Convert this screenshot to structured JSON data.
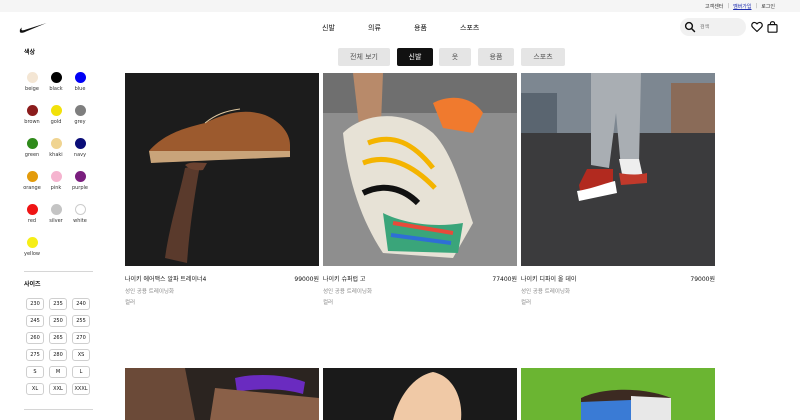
{
  "utility": {
    "customer_center": "고객센터",
    "signup": "멤버가입",
    "login": "로그인"
  },
  "nav": [
    "신발",
    "의류",
    "용품",
    "스포츠"
  ],
  "search": {
    "placeholder": "검색"
  },
  "sidebar": {
    "colors_title": "색상",
    "colors": [
      {
        "label": "beige",
        "hex": "#f4e6d4"
      },
      {
        "label": "black",
        "hex": "#000000"
      },
      {
        "label": "blue",
        "hex": "#0000f5"
      },
      {
        "label": "brown",
        "hex": "#8b1c1c"
      },
      {
        "label": "gold",
        "hex": "#f2e10a"
      },
      {
        "label": "grey",
        "hex": "#7e7e7e"
      },
      {
        "label": "green",
        "hex": "#2f8a1b"
      },
      {
        "label": "khaki",
        "hex": "#f0d491"
      },
      {
        "label": "navy",
        "hex": "#0a0d78"
      },
      {
        "label": "orange",
        "hex": "#e39b0b"
      },
      {
        "label": "pink",
        "hex": "#f5b4cf"
      },
      {
        "label": "purple",
        "hex": "#7a1e7e"
      },
      {
        "label": "red",
        "hex": "#ef1414"
      },
      {
        "label": "silver",
        "hex": "#c4c4c4"
      },
      {
        "label": "white",
        "hex": "#ffffff"
      },
      {
        "label": "yellow",
        "hex": "#f6ee16"
      }
    ],
    "sizes_title": "사이즈",
    "sizes": [
      "230",
      "235",
      "240",
      "245",
      "250",
      "255",
      "260",
      "265",
      "270",
      "275",
      "280",
      "XS",
      "S",
      "M",
      "L",
      "XL",
      "XXL",
      "XXXL"
    ]
  },
  "tabs": [
    {
      "label": "전체 보기",
      "active": false
    },
    {
      "label": "신발",
      "active": true
    },
    {
      "label": "옷",
      "active": false
    },
    {
      "label": "용품",
      "active": false
    },
    {
      "label": "스포츠",
      "active": false
    }
  ],
  "products": [
    {
      "name": "나이키 에어맥스 알파 트레이너4",
      "price": "99000원",
      "category": "성인 공용 트레이닝화",
      "colors": "컬러"
    },
    {
      "name": "나이키 슈퍼럽 고",
      "price": "77400원",
      "category": "성인 공용 트레이닝화",
      "colors": "컬러"
    },
    {
      "name": "나이키 디파이 올 데이",
      "price": "79000원",
      "category": "성인 공용 트레이닝화",
      "colors": "컬러"
    }
  ]
}
